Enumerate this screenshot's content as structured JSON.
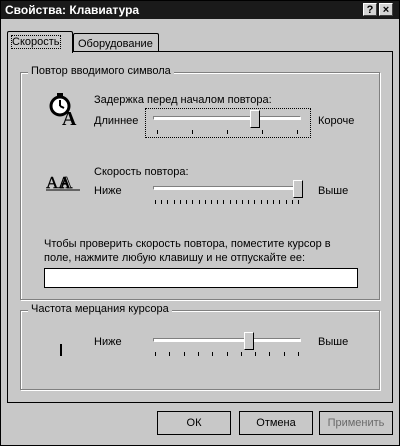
{
  "window": {
    "title": "Свойства: Клавиатура",
    "help_label": "?",
    "close_label": "×"
  },
  "tabs": [
    {
      "label": "Скорость"
    },
    {
      "label": "Оборудование"
    }
  ],
  "repeat_group": {
    "title": "Повтор вводимого символа",
    "delay": {
      "label": "Задержка перед началом повтора:",
      "min_label": "Длиннее",
      "max_label": "Короче",
      "value_fraction": 0.7
    },
    "rate": {
      "label": "Скорость повтора:",
      "min_label": "Ниже",
      "max_label": "Выше",
      "value_fraction": 1.0
    },
    "test_prompt_line1": "Чтобы проверить скорость повтора, поместите курсор в",
    "test_prompt_line2": "поле, нажмите любую клавишу и не отпускайте ее:",
    "test_input_value": ""
  },
  "blink_group": {
    "title": "Частота мерцания курсора",
    "min_label": "Ниже",
    "max_label": "Выше",
    "value_fraction": 0.65
  },
  "buttons": {
    "ok": "ОК",
    "cancel": "Отмена",
    "apply": "Применить"
  }
}
